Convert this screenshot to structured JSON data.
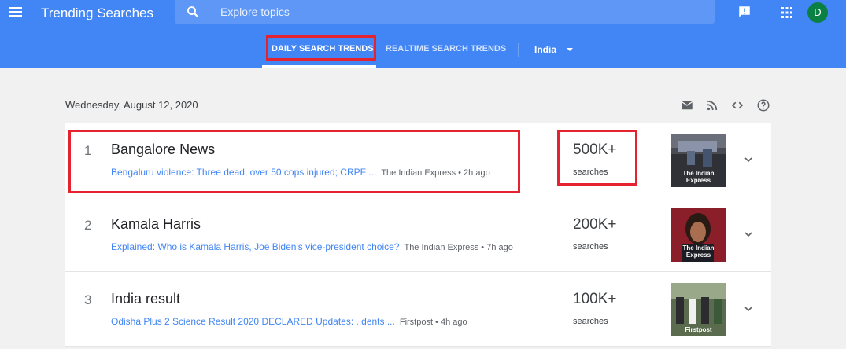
{
  "header": {
    "title": "Trending Searches",
    "search_placeholder": "Explore topics",
    "avatar_initial": "D"
  },
  "tabs": [
    {
      "label": "DAILY SEARCH TRENDS",
      "active": true
    },
    {
      "label": "REALTIME SEARCH TRENDS",
      "active": false
    }
  ],
  "geo": {
    "selected": "India"
  },
  "date": "Wednesday, August 12, 2020",
  "toolbar_icons": [
    "mail-icon",
    "rss-icon",
    "embed-code-icon",
    "help-icon"
  ],
  "trends": [
    {
      "rank": "1",
      "term": "Bangalore News",
      "article": "Bengaluru violence: Three dead, over 50 cops injured; CRPF ...",
      "source": "The Indian Express • 2h ago",
      "count": "500K+",
      "count_label": "searches",
      "thumb_caption": "The Indian Express"
    },
    {
      "rank": "2",
      "term": "Kamala Harris",
      "article": "Explained: Who is Kamala Harris, Joe Biden's vice-president choice?",
      "source": "The Indian Express • 7h ago",
      "count": "200K+",
      "count_label": "searches",
      "thumb_caption": "The Indian Express"
    },
    {
      "rank": "3",
      "term": "India result",
      "article": "Odisha Plus 2 Science Result 2020 DECLARED Updates: ..dents ...",
      "source": "Firstpost • 4h ago",
      "count": "100K+",
      "count_label": "searches",
      "thumb_caption": "Firstpost"
    }
  ],
  "colors": {
    "header_bg": "#4285f4",
    "search_bg": "#5e97f6",
    "avatar_bg": "#0b8043",
    "highlight": "#e5232f",
    "link": "#4285f4"
  }
}
